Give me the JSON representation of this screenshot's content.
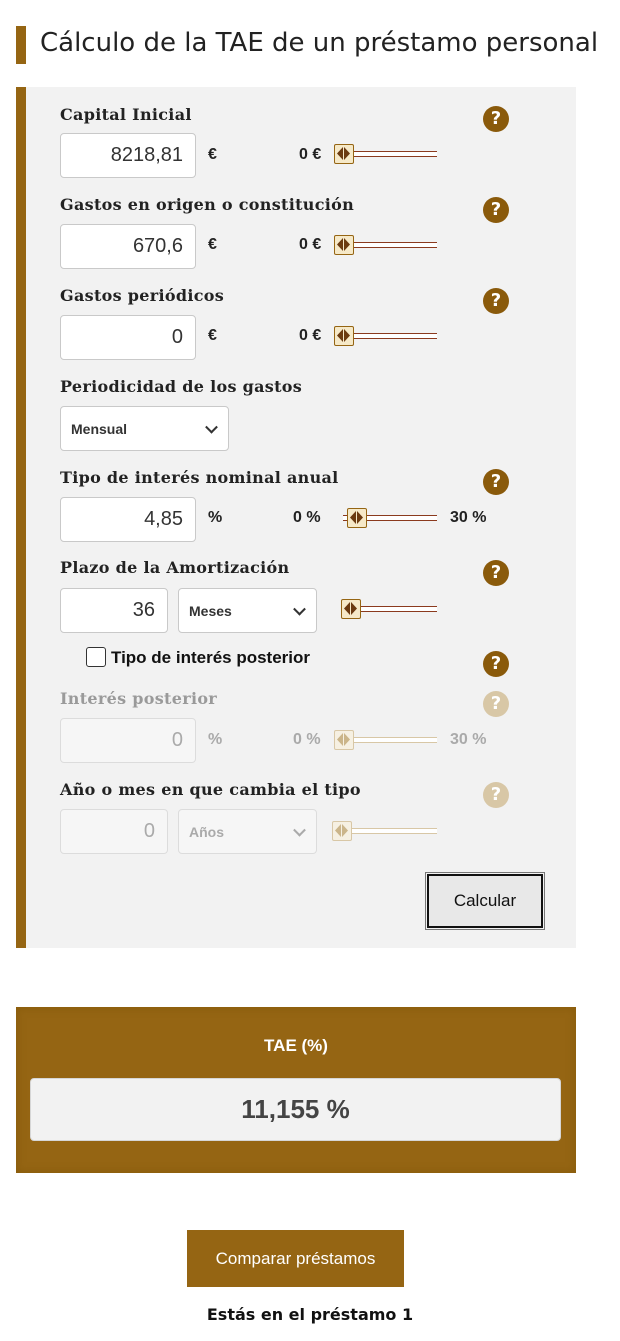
{
  "page": {
    "title": "Cálculo de la TAE de un préstamo personal"
  },
  "form": {
    "capital": {
      "label": "Capital Inicial",
      "value": "8218,81",
      "unit": "€",
      "min_label": "0 €",
      "help": "?"
    },
    "gastos_origen": {
      "label": "Gastos en origen o constitución",
      "value": "670,6",
      "unit": "€",
      "min_label": "0 €",
      "help": "?"
    },
    "gastos_periodicos": {
      "label": "Gastos periódicos",
      "value": "0",
      "unit": "€",
      "min_label": "0 €",
      "help": "?"
    },
    "periodicidad": {
      "label": "Periodicidad de los gastos",
      "selected": "Mensual"
    },
    "tipo_nominal": {
      "label": "Tipo de interés nominal anual",
      "value": "4,85",
      "unit": "%",
      "min_label": "0 %",
      "max_label": "30 %",
      "help": "?"
    },
    "plazo": {
      "label": "Plazo de la Amortización",
      "value": "36",
      "unit_selected": "Meses",
      "help": "?"
    },
    "posterior_checkbox": {
      "label": "Tipo de interés posterior",
      "checked": false,
      "help": "?"
    },
    "interes_posterior": {
      "label": "Interés posterior",
      "value": "0",
      "unit": "%",
      "min_label": "0 %",
      "max_label": "30 %",
      "help": "?"
    },
    "cambio_tipo": {
      "label": "Año o mes en que cambia el tipo",
      "value": "0",
      "unit_selected": "Años",
      "help": "?"
    },
    "calcular_label": "Calcular"
  },
  "result": {
    "label": "TAE (%)",
    "value": "11,155 %"
  },
  "compare_label": "Comparar préstamos",
  "footer_text": "Estás en el préstamo 1",
  "colors": {
    "brand": "#956513",
    "panel": "#f2f2f2",
    "track": "#8b3a1e"
  },
  "icons": [
    "help-icon",
    "slider-thumb-icon",
    "chevron-down-icon",
    "checkbox-icon"
  ]
}
